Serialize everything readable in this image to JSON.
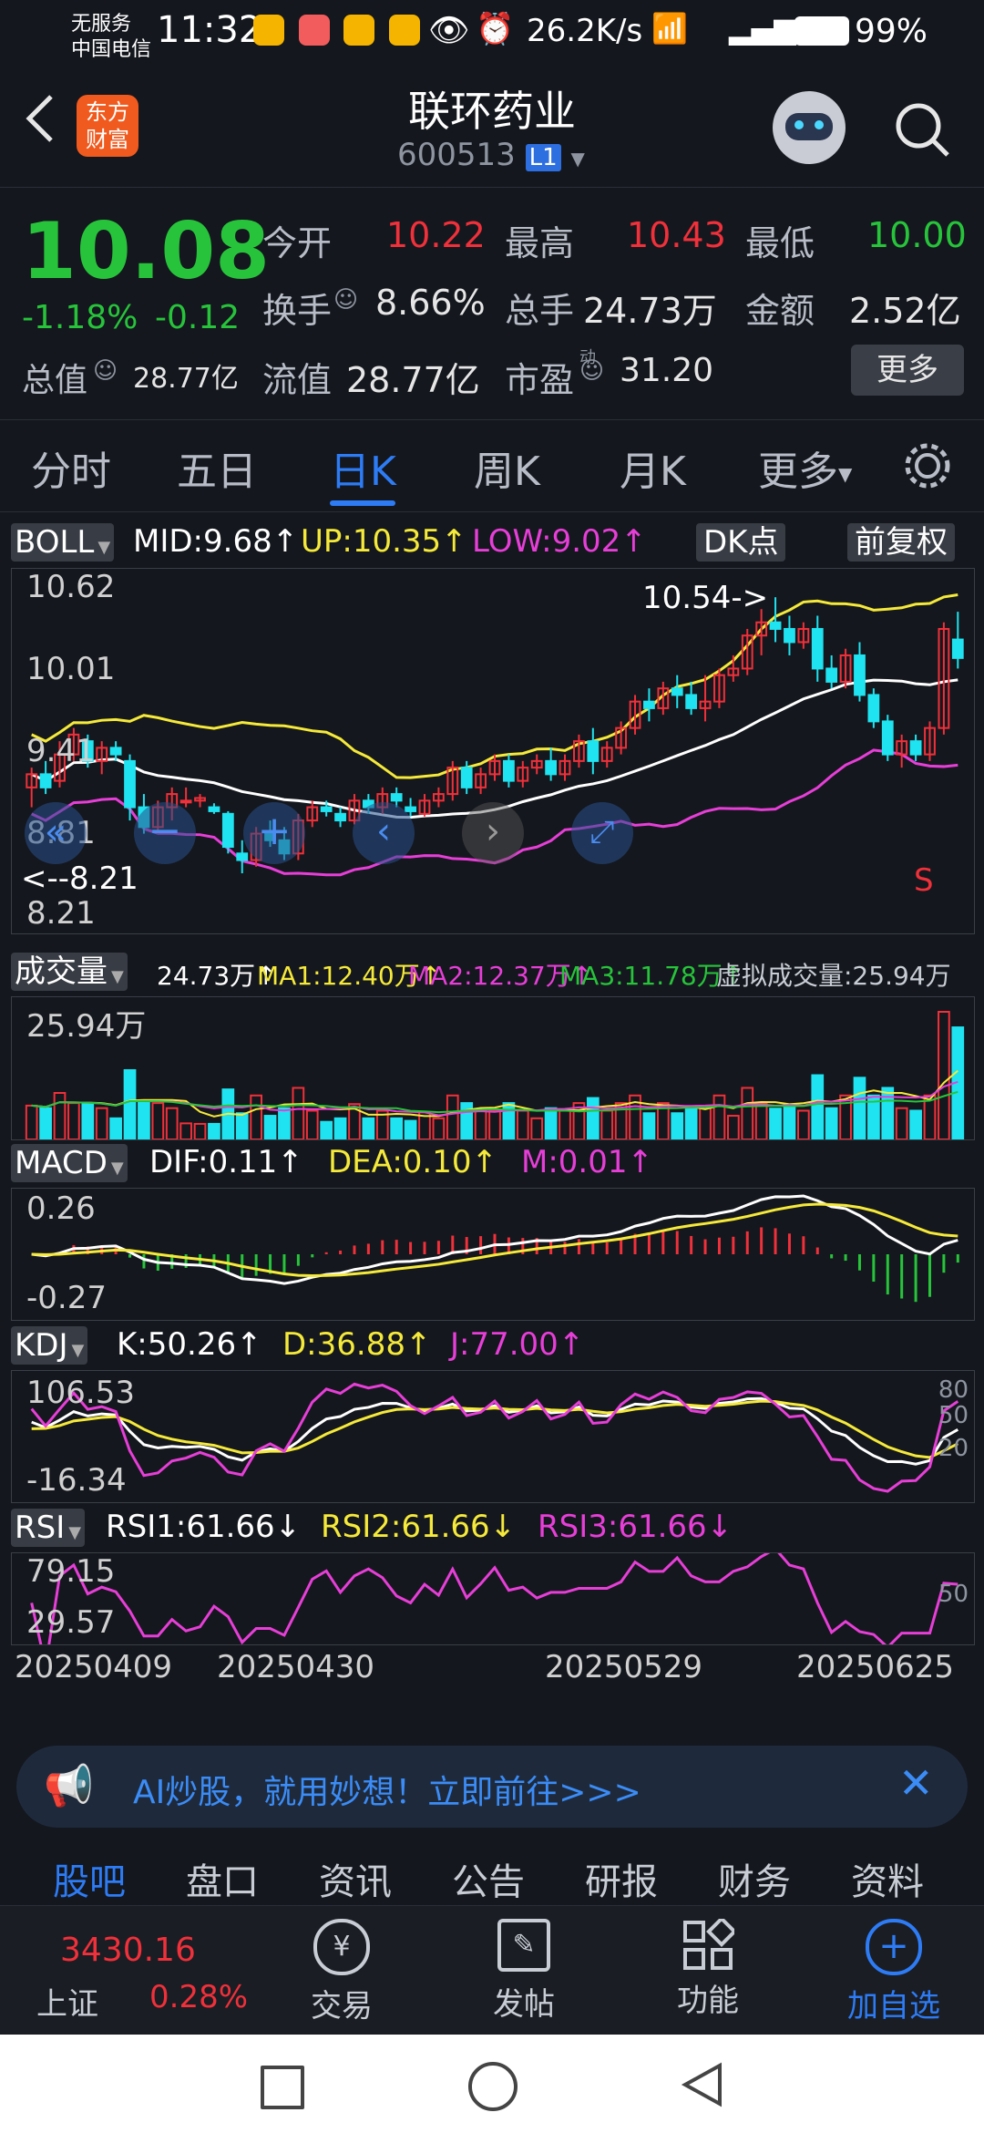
{
  "status_bar": {
    "carrier_line1": "无服务",
    "carrier_line2": "中国电信",
    "time": "11:32",
    "net_speed": "26.2K/s",
    "battery": "99%"
  },
  "header": {
    "logo_text_line1": "东方",
    "logo_text_line2": "财富",
    "title": "联环药业",
    "code": "600513",
    "level_badge": "L1"
  },
  "quote": {
    "price": "10.08",
    "change_pct": "-1.18%",
    "change": "-0.12",
    "open_label": "今开",
    "open": "10.22",
    "high_label": "最高",
    "high": "10.43",
    "low_label": "最低",
    "low": "10.00",
    "turnover_label": "换手",
    "turnover": "8.66%",
    "volume_label": "总手",
    "volume": "24.73万",
    "amount_label": "金额",
    "amount": "2.52亿",
    "mktcap_label": "总值",
    "mktcap": "28.77亿",
    "float_label": "流值",
    "float_cap": "28.77亿",
    "pe_label": "市盈",
    "pe_sup": "动",
    "pe": "31.20",
    "more_button": "更多"
  },
  "tabs": [
    "分时",
    "五日",
    "日K",
    "周K",
    "月K",
    "更多"
  ],
  "active_tab": 2,
  "chart_colors": {
    "up": "#f0303a",
    "down": "#1fe3f0",
    "mid": "#ffffff",
    "upper": "#f5e93a",
    "lower": "#e73ed8",
    "ma3": "#27c43b"
  },
  "boll": {
    "name": "BOLL",
    "mid": "MID:9.68↑",
    "up": "UP:10.35↑",
    "low": "LOW:9.02↑",
    "dk_button": "DK点",
    "adjust_button": "前复权",
    "y_labels": [
      "10.62",
      "10.01",
      "9.41",
      "8.81",
      "8.21"
    ],
    "max_note": "10.54->",
    "min_note": "<--8.21",
    "sell_mark": "S"
  },
  "volume_ind": {
    "name": "成交量",
    "vol": "24.73万↑",
    "ma1": "MA1:12.40万↑",
    "ma2": "MA2:12.37万↑",
    "ma3": "MA3:11.78万↑",
    "virtual": "虚拟成交量:25.94万",
    "y_label": "25.94万"
  },
  "macd": {
    "name": "MACD",
    "dif": "DIF:0.11↑",
    "dea": "DEA:0.10↑",
    "m": "M:0.01↑",
    "y_labels": [
      "0.26",
      "-0.27"
    ]
  },
  "kdj": {
    "name": "KDJ",
    "k": "K:50.26↑",
    "d": "D:36.88↑",
    "j": "J:77.00↑",
    "y_labels": [
      "106.53",
      "-16.34"
    ],
    "right_labels": [
      "80",
      "50",
      "20"
    ]
  },
  "rsi": {
    "name": "RSI",
    "r1": "RSI1:61.66↓",
    "r2": "RSI2:61.66↓",
    "r3": "RSI3:61.66↓",
    "y_labels": [
      "79.15",
      "29.57"
    ],
    "right_label": "50"
  },
  "dates": [
    "20250409",
    "20250430",
    "20250529",
    "20250625"
  ],
  "ai_banner": "AI炒股，就用妙想！立即前往>>>",
  "news_tabs": [
    "股吧",
    "盘口",
    "资讯",
    "公告",
    "研报",
    "财务",
    "资料"
  ],
  "bottom_bar": {
    "index_value": "3430.16",
    "index_name": "上证",
    "index_change": "0.28%",
    "trade": "交易",
    "post": "发帖",
    "functions": "功能",
    "add_watch": "加自选"
  },
  "chart_data": {
    "type": "candlestick",
    "title": "联环药业 600513 日K",
    "x_start": "20250409",
    "x_end": "20250625",
    "ylim": [
      8.21,
      10.62
    ],
    "candles": [
      [
        9.1,
        9.25,
        8.95,
        9.2
      ],
      [
        9.2,
        9.3,
        9.05,
        9.1
      ],
      [
        9.15,
        9.45,
        9.1,
        9.35
      ],
      [
        9.35,
        9.55,
        9.3,
        9.5
      ],
      [
        9.45,
        9.5,
        9.25,
        9.3
      ],
      [
        9.3,
        9.45,
        9.2,
        9.4
      ],
      [
        9.4,
        9.45,
        9.3,
        9.35
      ],
      [
        9.3,
        9.35,
        8.85,
        8.95
      ],
      [
        8.95,
        9.05,
        8.75,
        8.8
      ],
      [
        8.8,
        9.0,
        8.75,
        8.95
      ],
      [
        8.95,
        9.1,
        8.85,
        9.05
      ],
      [
        9.0,
        9.1,
        8.95,
        9.0
      ],
      [
        9.0,
        9.05,
        8.95,
        9.02
      ],
      [
        8.95,
        8.98,
        8.9,
        8.92
      ],
      [
        8.9,
        8.92,
        8.6,
        8.65
      ],
      [
        8.6,
        8.7,
        8.45,
        8.55
      ],
      [
        8.55,
        8.8,
        8.5,
        8.75
      ],
      [
        8.75,
        8.85,
        8.65,
        8.7
      ],
      [
        8.7,
        8.8,
        8.55,
        8.6
      ],
      [
        8.6,
        8.9,
        8.55,
        8.85
      ],
      [
        8.85,
        9.0,
        8.8,
        8.95
      ],
      [
        8.95,
        9.0,
        8.88,
        8.92
      ],
      [
        8.9,
        8.95,
        8.8,
        8.85
      ],
      [
        8.85,
        9.05,
        8.82,
        9.0
      ],
      [
        9.0,
        9.05,
        8.9,
        8.95
      ],
      [
        8.95,
        9.1,
        8.9,
        9.05
      ],
      [
        9.05,
        9.1,
        8.95,
        9.0
      ],
      [
        8.95,
        9.02,
        8.88,
        8.92
      ],
      [
        8.9,
        9.05,
        8.88,
        9.0
      ],
      [
        9.0,
        9.1,
        8.95,
        9.05
      ],
      [
        9.05,
        9.3,
        9.0,
        9.25
      ],
      [
        9.25,
        9.3,
        9.05,
        9.1
      ],
      [
        9.1,
        9.25,
        9.05,
        9.2
      ],
      [
        9.2,
        9.35,
        9.15,
        9.3
      ],
      [
        9.3,
        9.35,
        9.1,
        9.15
      ],
      [
        9.15,
        9.3,
        9.1,
        9.25
      ],
      [
        9.25,
        9.35,
        9.2,
        9.3
      ],
      [
        9.3,
        9.4,
        9.15,
        9.2
      ],
      [
        9.2,
        9.35,
        9.15,
        9.3
      ],
      [
        9.3,
        9.5,
        9.25,
        9.45
      ],
      [
        9.45,
        9.55,
        9.2,
        9.3
      ],
      [
        9.3,
        9.45,
        9.25,
        9.4
      ],
      [
        9.4,
        9.6,
        9.35,
        9.55
      ],
      [
        9.55,
        9.8,
        9.5,
        9.75
      ],
      [
        9.75,
        9.85,
        9.6,
        9.7
      ],
      [
        9.7,
        9.9,
        9.65,
        9.85
      ],
      [
        9.85,
        9.95,
        9.7,
        9.8
      ],
      [
        9.8,
        9.9,
        9.65,
        9.7
      ],
      [
        9.7,
        9.95,
        9.6,
        9.75
      ],
      [
        9.75,
        10.0,
        9.7,
        9.95
      ],
      [
        9.95,
        10.1,
        9.9,
        10.0
      ],
      [
        10.0,
        10.3,
        9.95,
        10.25
      ],
      [
        10.25,
        10.45,
        10.1,
        10.35
      ],
      [
        10.35,
        10.54,
        10.2,
        10.3
      ],
      [
        10.3,
        10.4,
        10.1,
        10.2
      ],
      [
        10.2,
        10.35,
        10.15,
        10.3
      ],
      [
        10.3,
        10.4,
        9.9,
        10.0
      ],
      [
        10.0,
        10.1,
        9.85,
        9.9
      ],
      [
        9.9,
        10.15,
        9.85,
        10.1
      ],
      [
        10.1,
        10.2,
        9.75,
        9.8
      ],
      [
        9.8,
        9.85,
        9.55,
        9.6
      ],
      [
        9.6,
        9.65,
        9.3,
        9.35
      ],
      [
        9.35,
        9.5,
        9.25,
        9.45
      ],
      [
        9.45,
        9.5,
        9.3,
        9.35
      ],
      [
        9.35,
        9.6,
        9.3,
        9.55
      ],
      [
        9.55,
        10.35,
        9.5,
        10.3
      ],
      [
        10.22,
        10.43,
        10.0,
        10.08
      ]
    ],
    "volume_ymax": "25.94万"
  }
}
